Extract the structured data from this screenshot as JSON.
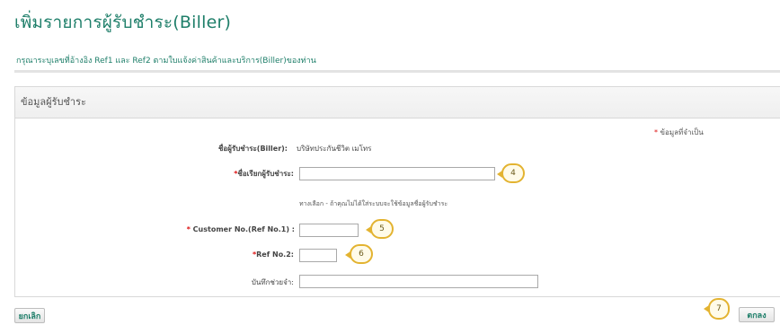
{
  "page": {
    "title": "เพิ่มรายการผู้รับชำระ(Biller)",
    "subtitle": "กรุณาระบุเลขที่อ้างอิง Ref1 และ Ref2 ตามใบแจ้งค่าสินค้าและบริการ(Biller)ของท่าน"
  },
  "panel": {
    "header": "ข้อมูลผู้รับชำระ",
    "required_note": "ข้อมูลที่จำเป็น",
    "biller_name_label": "ชื่อผู้รับชำระ(Biller):",
    "biller_name_value": "บริษัทประกันชีวิต เมโทร",
    "nickname_label": "ชื่อเรียกผู้รับชำระ:",
    "nickname_value": "",
    "nickname_hint": "ทางเลือก - ถ้าคุณไม่ได้ใส่ระบบจะใช้ข้อมูลชื่อผู้รับชำระ",
    "ref1_label": "Customer No.(Ref No.1) :",
    "ref1_value": "",
    "ref2_label": "Ref No.2:",
    "ref2_value": "",
    "memo_label": "บันทึกช่วยจำ:",
    "memo_value": ""
  },
  "markers": {
    "m4": "4",
    "m5": "5",
    "m6": "6",
    "m7": "7"
  },
  "buttons": {
    "cancel": "ยกเลิก",
    "next": "ตกลง"
  },
  "colors": {
    "accent": "#1f7f6a",
    "required": "#dd1111",
    "marker": "#e3b330"
  }
}
